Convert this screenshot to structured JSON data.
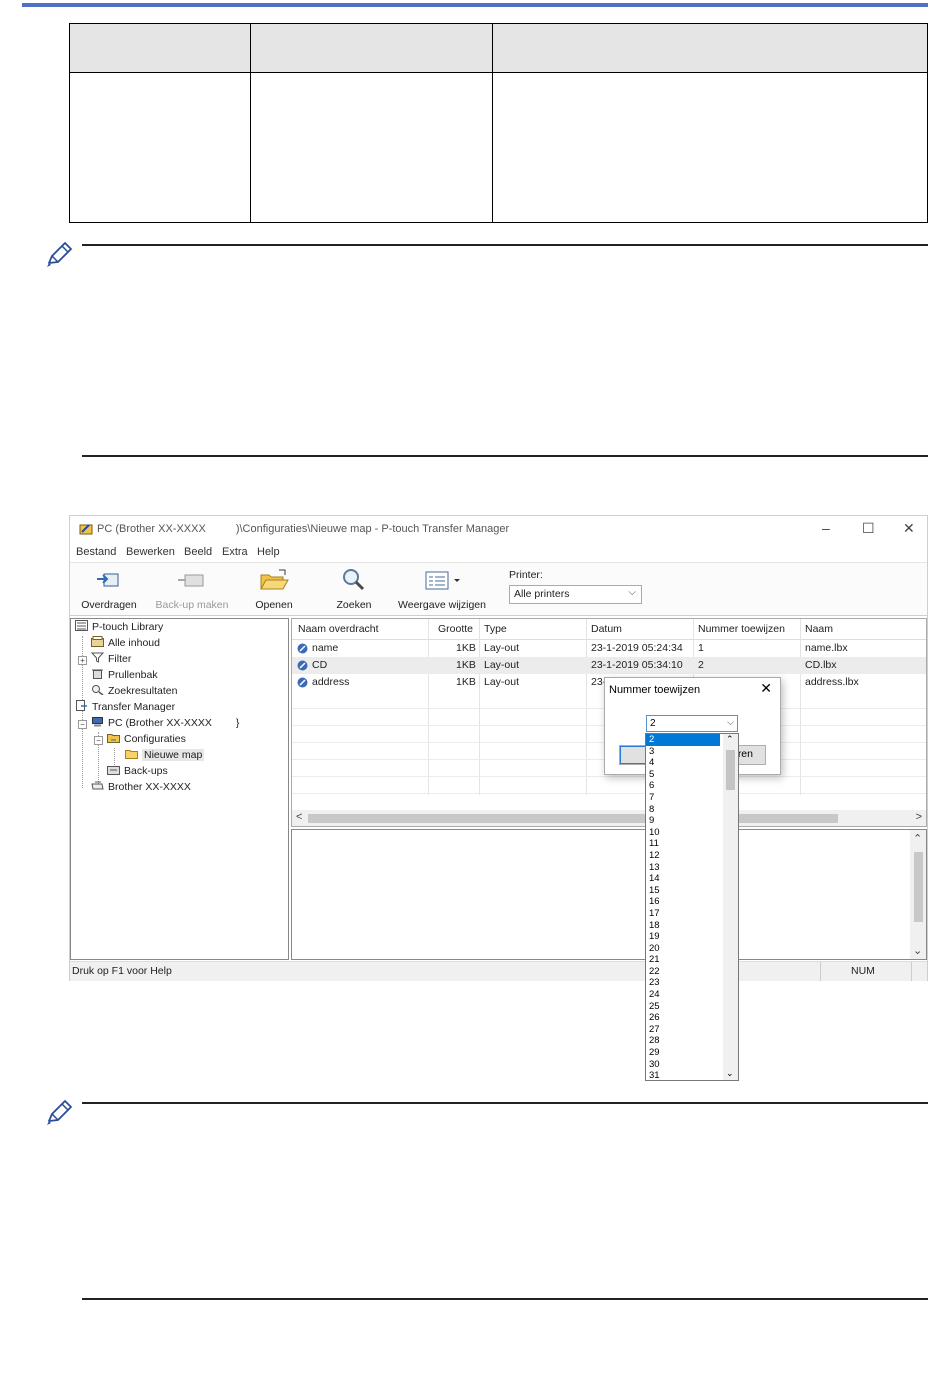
{
  "colors": {
    "accent_bar": "#5070c8",
    "table_header": "#e5e5e5",
    "selection": "#0078d7"
  },
  "window": {
    "title_prefix": "PC (Brother XX-XXXX",
    "title_suffix": ")\\Configuraties\\Nieuwe map - P-touch Transfer Manager",
    "controls": {
      "minimize": "–",
      "maximize": "☐",
      "close": "✕"
    }
  },
  "menu": [
    "Bestand",
    "Bewerken",
    "Beeld",
    "Extra",
    "Help"
  ],
  "toolbar": {
    "transfer": "Overdragen",
    "backup": "Back-up maken",
    "open": "Openen",
    "search": "Zoeken",
    "view": "Weergave wijzigen",
    "printer_label": "Printer:",
    "printer_value": "Alle printers"
  },
  "tree": {
    "library": "P-touch Library",
    "all": "Alle inhoud",
    "filter": "Filter",
    "trash": "Prullenbak",
    "results": "Zoekresultaten",
    "manager": "Transfer Manager",
    "pc": "PC (Brother XX-XXXX",
    "pc_close": "}",
    "config": "Configuraties",
    "new_folder": "Nieuwe map",
    "backups": "Back-ups",
    "brother": "Brother XX-XXXX"
  },
  "list": {
    "columns": [
      "Naam overdracht",
      "Grootte",
      "Type",
      "Datum",
      "Nummer toewijzen",
      "Naam"
    ],
    "rows": [
      {
        "name": "name",
        "size": "1KB",
        "type": "Lay-out",
        "date": "23-1-2019 05:24:34",
        "num": "1",
        "file": "name.lbx"
      },
      {
        "name": "CD",
        "size": "1KB",
        "type": "Lay-out",
        "date": "23-1-2019 05:34:10",
        "num": "2",
        "file": "CD.lbx"
      },
      {
        "name": "address",
        "size": "1KB",
        "type": "Lay-out",
        "date": "23-",
        "num": "",
        "file": "address.lbx"
      }
    ]
  },
  "status": {
    "help": "Druk op F1 voor Help",
    "num": "NUM"
  },
  "dialog": {
    "title": "Nummer toewijzen",
    "close": "✕",
    "selected": "2",
    "button_partial": "ren",
    "options": [
      "2",
      "3",
      "4",
      "5",
      "6",
      "7",
      "8",
      "9",
      "10",
      "11",
      "12",
      "13",
      "14",
      "15",
      "16",
      "17",
      "18",
      "19",
      "20",
      "21",
      "22",
      "23",
      "24",
      "25",
      "26",
      "27",
      "28",
      "29",
      "30",
      "31"
    ]
  }
}
